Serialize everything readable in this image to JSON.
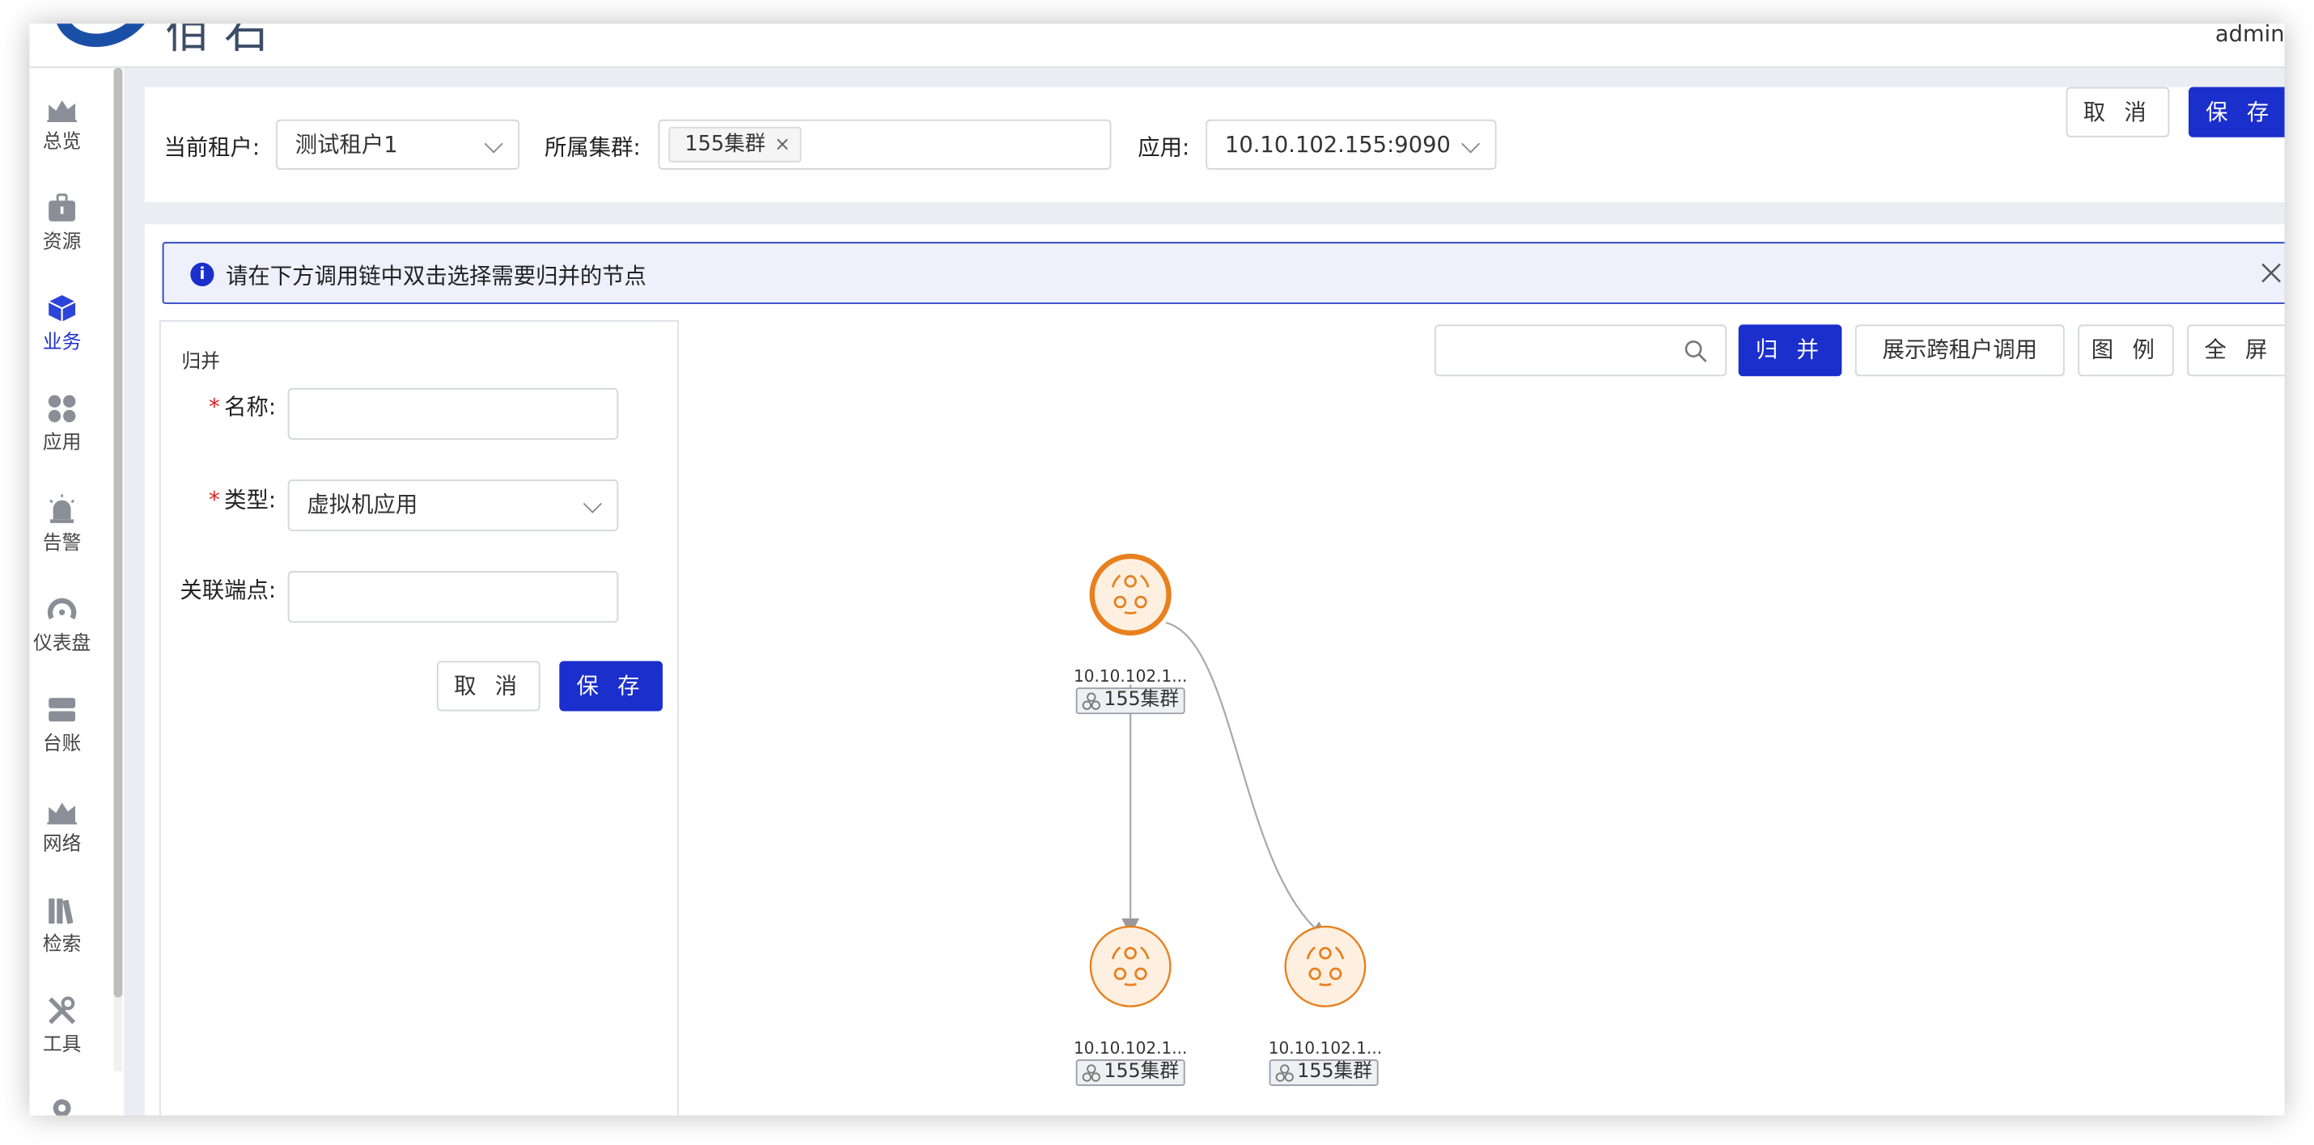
{
  "brand": {
    "logo_text": "佰石"
  },
  "user": {
    "name": "admin"
  },
  "sidebar": {
    "items": [
      {
        "label": "总览",
        "icon": "chart-area-icon"
      },
      {
        "label": "资源",
        "icon": "briefcase-icon"
      },
      {
        "label": "业务",
        "icon": "cube-icon",
        "active": true
      },
      {
        "label": "应用",
        "icon": "apps-icon"
      },
      {
        "label": "告警",
        "icon": "alarm-icon"
      },
      {
        "label": "仪表盘",
        "icon": "gauge-icon"
      },
      {
        "label": "台账",
        "icon": "ledger-icon"
      },
      {
        "label": "网络",
        "icon": "chart-area-icon"
      },
      {
        "label": "检索",
        "icon": "books-icon"
      },
      {
        "label": "工具",
        "icon": "tools-icon"
      }
    ]
  },
  "filters": {
    "tenant_label": "当前租户:",
    "tenant_value": "测试租户1",
    "cluster_label": "所属集群:",
    "cluster_tag": "155集群",
    "app_label": "应用:",
    "app_value": "10.10.102.155:9090",
    "cancel": "取 消",
    "save": "保 存"
  },
  "alert": {
    "message": "请在下方调用链中双击选择需要归并的节点",
    "info_glyph": "i"
  },
  "merge_form": {
    "title": "归并",
    "name_label": "名称:",
    "name_value": "",
    "type_label": "类型:",
    "type_value": "虚拟机应用",
    "endpoint_label": "关联端点:",
    "endpoint_value": "",
    "required_mark": "*",
    "cancel": "取 消",
    "save": "保 存"
  },
  "graph_toolbar": {
    "search_value": "",
    "merge": "归 并",
    "show_cross_tenant": "展示跨租户调用",
    "legend": "图 例",
    "fullscreen": "全 屏"
  },
  "nodes": [
    {
      "label": "10.10.102.1...",
      "cluster": "155集群",
      "selected": true
    },
    {
      "label": "10.10.102.1...",
      "cluster": "155集群",
      "selected": false
    },
    {
      "label": "10.10.102.1...",
      "cluster": "155集群",
      "selected": false
    }
  ],
  "colors": {
    "accent": "#1b2fcc",
    "node_orange": "#e8801e",
    "node_fill": "#fdf0e1"
  }
}
